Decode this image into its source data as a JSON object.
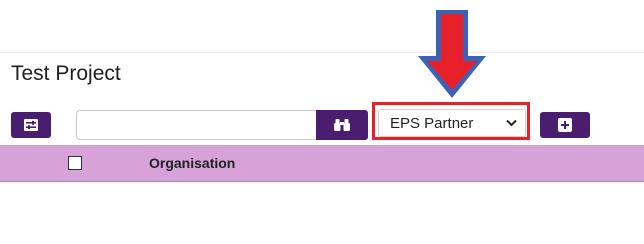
{
  "page": {
    "title": "Test Project"
  },
  "toolbar": {
    "search_value": "",
    "search_placeholder": "",
    "select_value": "EPS Partner"
  },
  "table": {
    "columns": [
      "Organisation"
    ]
  },
  "icons": {
    "filter": "sliders-icon",
    "search": "binoculars-icon",
    "add": "plus-square-icon",
    "dropdown": "chevron-down-icon",
    "annotation": "down-arrow-icon"
  },
  "colors": {
    "button_bg": "#4b1d6e",
    "header_bg": "#d6a2d8",
    "highlight_border": "#e8202a",
    "arrow_fill": "#e8202a",
    "arrow_outline": "#3a63b8"
  }
}
